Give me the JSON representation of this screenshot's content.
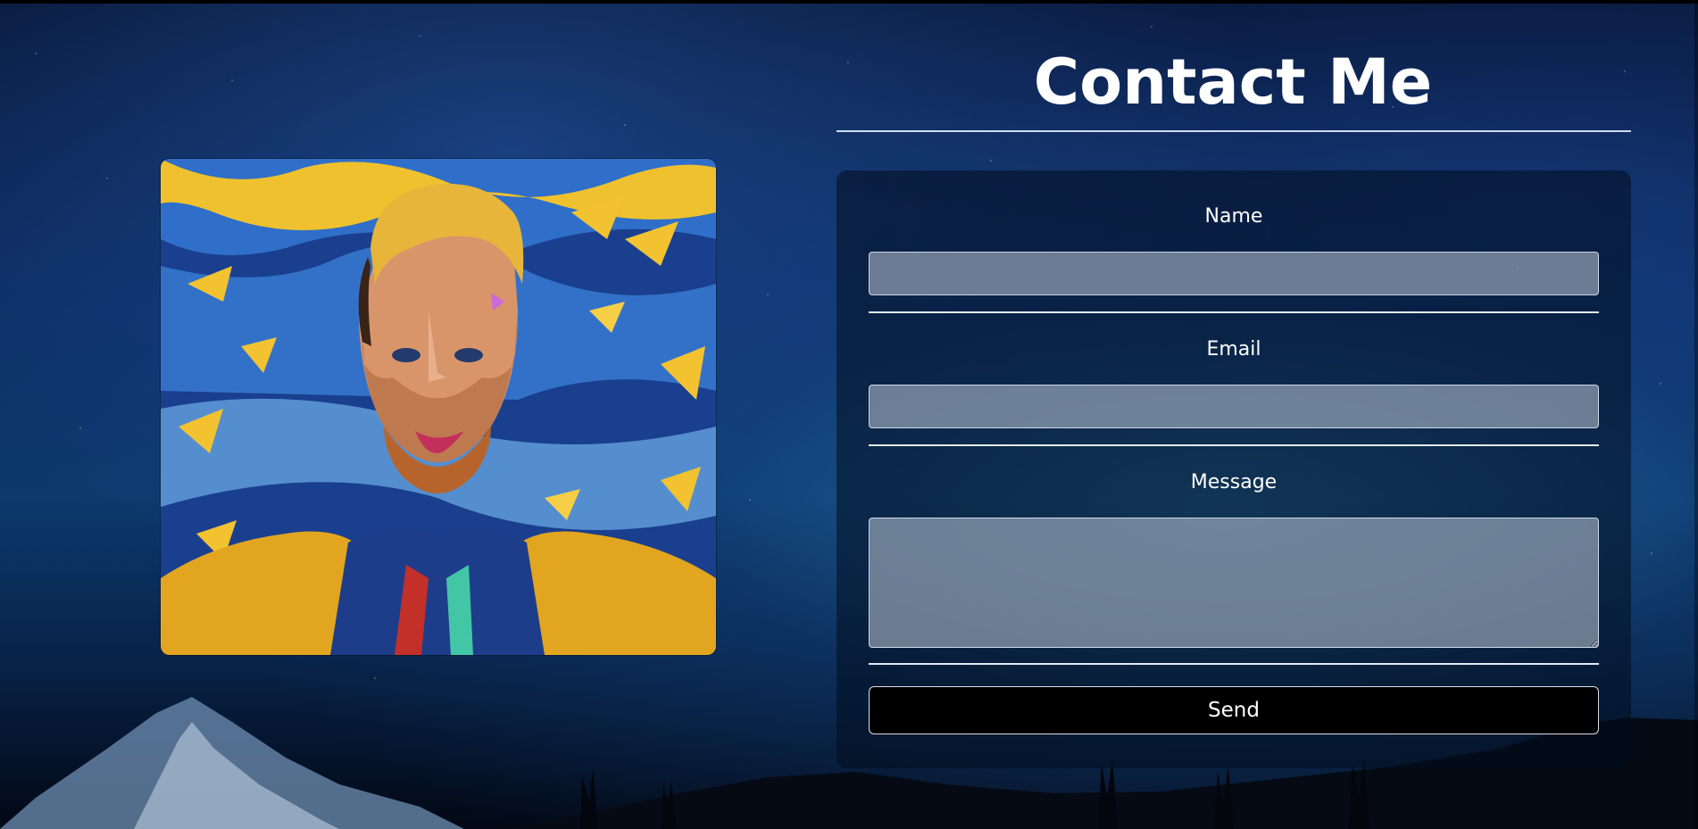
{
  "header": {
    "title": "Contact Me"
  },
  "form": {
    "name_label": "Name",
    "name_value": "",
    "email_label": "Email",
    "email_value": "",
    "message_label": "Message",
    "message_value": "",
    "send_label": "Send"
  },
  "colors": {
    "panel": "#020c1e",
    "input_fill": "#bec8d7",
    "button": "#000000",
    "text": "#ffffff"
  }
}
